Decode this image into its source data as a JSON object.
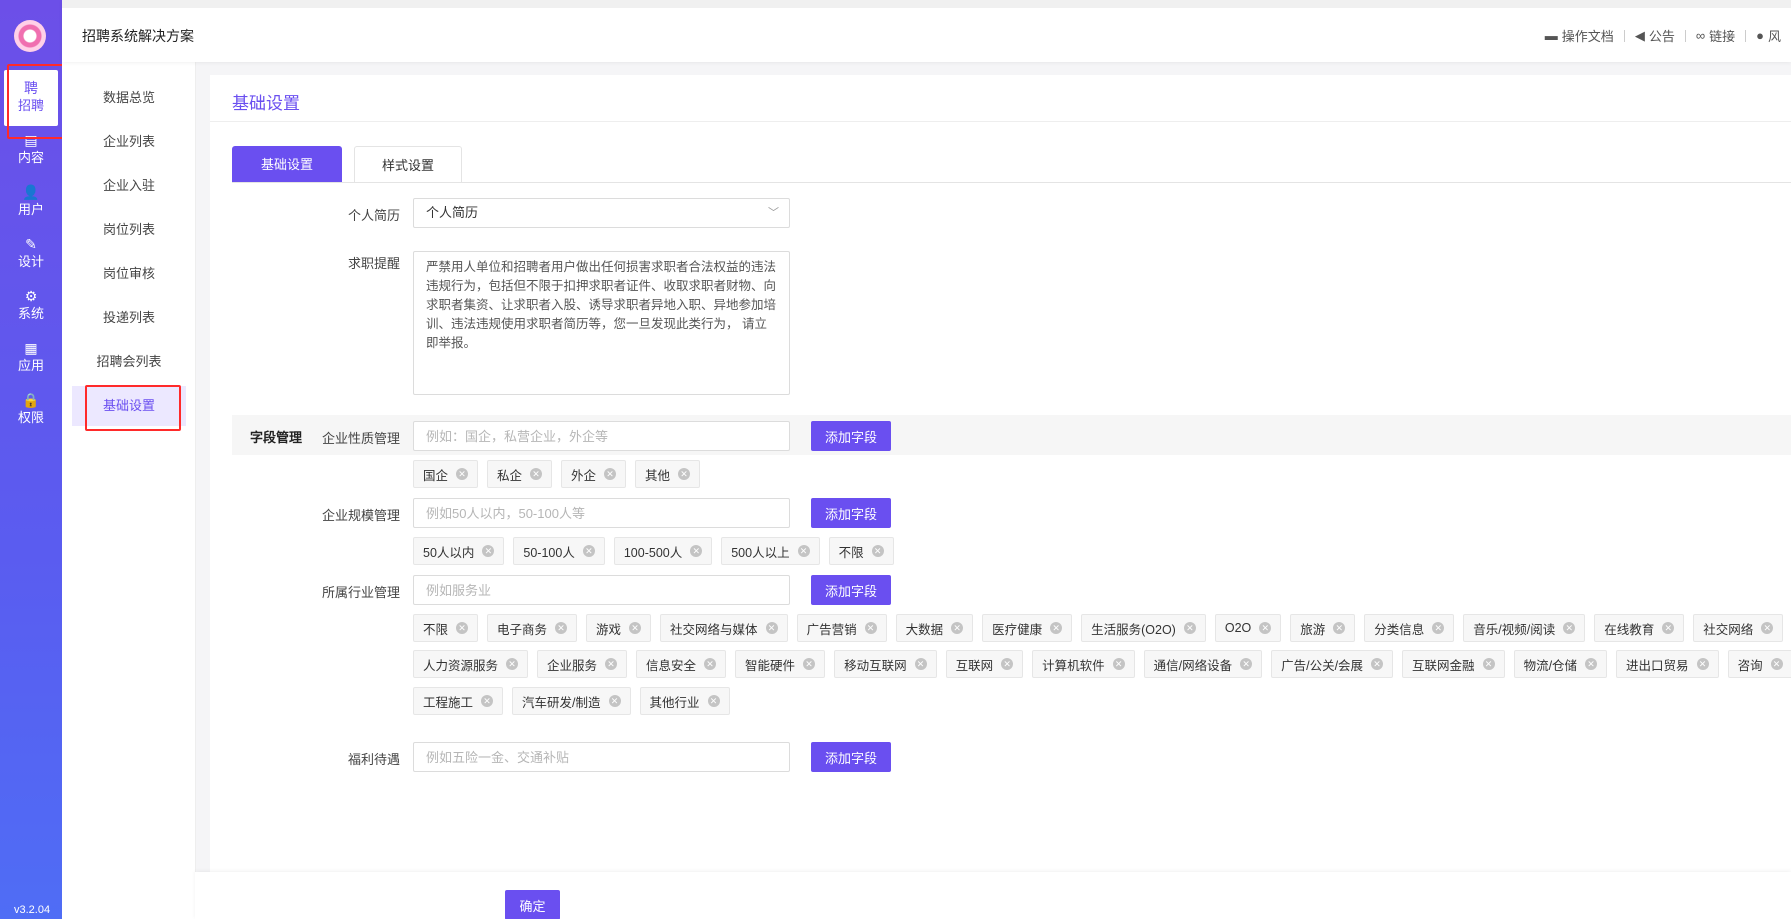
{
  "header": {
    "title": "招聘系统解决方案",
    "links": [
      {
        "label": "操作文档",
        "icon": "folder-icon"
      },
      {
        "label": "公告",
        "icon": "megaphone-icon"
      },
      {
        "label": "链接",
        "icon": "link-icon"
      },
      {
        "label": "风",
        "icon": "palette-icon"
      }
    ]
  },
  "rail": {
    "items": [
      {
        "label": "招聘",
        "glyph": "聘"
      },
      {
        "label": "内容",
        "glyph": "▤"
      },
      {
        "label": "用户",
        "glyph": "👤"
      },
      {
        "label": "设计",
        "glyph": "✎"
      },
      {
        "label": "系统",
        "glyph": "⚙"
      },
      {
        "label": "应用",
        "glyph": "▦"
      },
      {
        "label": "权限",
        "glyph": "🔒"
      }
    ],
    "version": "v3.2.04"
  },
  "submenu": {
    "items": [
      "数据总览",
      "企业列表",
      "企业入驻",
      "岗位列表",
      "岗位审核",
      "投递列表",
      "招聘会列表",
      "基础设置"
    ]
  },
  "page": {
    "title": "基础设置",
    "tabs": [
      "基础设置",
      "样式设置"
    ],
    "resume": {
      "label": "个人简历",
      "value": "个人简历"
    },
    "reminder": {
      "label": "求职提醒",
      "value": "严禁用人单位和招聘者用户做出任何损害求职者合法权益的违法违规行为，包括但不限于扣押求职者证件、收取求职者财物、向求职者集资、让求职者入股、诱导求职者异地入职、异地参加培训、违法违规使用求职者简历等，您一旦发现此类行为， 请立即举报。"
    },
    "section_title": "字段管理",
    "add_label": "添加字段",
    "confirm_label": "确定",
    "fields": {
      "nature": {
        "label": "企业性质管理",
        "placeholder": "例如：国企，私营企业，外企等",
        "tags": [
          "国企",
          "私企",
          "外企",
          "其他"
        ]
      },
      "scale": {
        "label": "企业规模管理",
        "placeholder": "例如50人以内，50-100人等",
        "tags": [
          "50人以内",
          "50-100人",
          "100-500人",
          "500人以上",
          "不限"
        ]
      },
      "industry": {
        "label": "所属行业管理",
        "placeholder": "例如服务业",
        "tags_row1": [
          "不限",
          "电子商务",
          "游戏",
          "社交网络与媒体",
          "广告营销",
          "大数据",
          "医疗健康",
          "生活服务(O2O)",
          "O2O",
          "旅游",
          "分类信息",
          "音乐/视频/阅读",
          "在线教育",
          "社交网络"
        ],
        "tags_row2": [
          "人力资源服务",
          "企业服务",
          "信息安全",
          "智能硬件",
          "移动互联网",
          "互联网",
          "计算机软件",
          "通信/网络设备",
          "广告/公关/会展",
          "互联网金融",
          "物流/仓储",
          "进出口贸易",
          "咨询"
        ],
        "tags_row3": [
          "工程施工",
          "汽车研发/制造",
          "其他行业"
        ]
      },
      "welfare": {
        "label": "福利待遇",
        "placeholder": "例如五险一金、交通补贴"
      }
    }
  }
}
